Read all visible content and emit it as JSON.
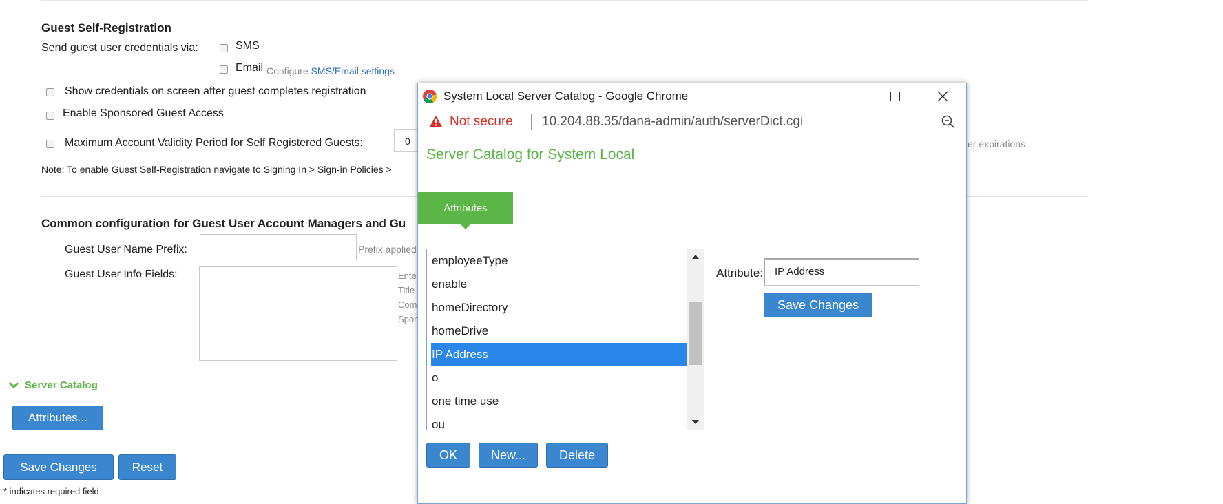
{
  "guest_reg": {
    "heading": "Guest Self-Registration",
    "send_label": "Send guest user credentials via:",
    "sms_label": "SMS",
    "email_label": "Email",
    "configure_prefix": "Configure ",
    "configure_link": "SMS/Email settings",
    "show_credentials": "Show credentials on screen after guest completes registration",
    "sponsored": "Enable Sponsored Guest Access",
    "max_validity": "Maximum Account Validity Period for Self Registered Guests:",
    "max_validity_value": "0",
    "note": "Note: To enable Guest Self-Registration navigate to Signing In > Sign-in Policies >",
    "expirations_tail": "er expirations."
  },
  "common_config": {
    "heading": "Common configuration for Guest User Account Managers and Gu",
    "prefix_label": "Guest User Name Prefix:",
    "prefix_value": "",
    "prefix_hint": "Prefix applied",
    "info_label": "Guest User Info Fields:",
    "info_value": "",
    "info_hints": [
      "Ente",
      "Title",
      "Com",
      "Spor"
    ]
  },
  "server_catalog": {
    "section_label": "Server Catalog",
    "attributes_button": "Attributes..."
  },
  "footer": {
    "save_button": "Save Changes",
    "reset_button": "Reset",
    "required_note": "* indicates required field"
  },
  "popup": {
    "window_title": "System Local Server Catalog - Google Chrome",
    "not_secure": "Not secure",
    "url": "10.204.88.35/dana-admin/auth/serverDict.cgi",
    "heading": "Server Catalog for System Local",
    "tab_label": "Attributes",
    "list_items": [
      "employeeType",
      "enable",
      "homeDirectory",
      "homeDrive",
      "IP Address",
      "o",
      "one time use",
      "ou"
    ],
    "selected_item": "IP Address",
    "attribute_label": "Attribute:",
    "attribute_value": "IP Address",
    "save_button": "Save Changes",
    "ok_button": "OK",
    "new_button": "New...",
    "delete_button": "Delete"
  },
  "colors": {
    "accent_green": "#5bb647",
    "button_blue": "#3a87cf",
    "selection_blue": "#2a86e8",
    "warning_red": "#d93025"
  }
}
